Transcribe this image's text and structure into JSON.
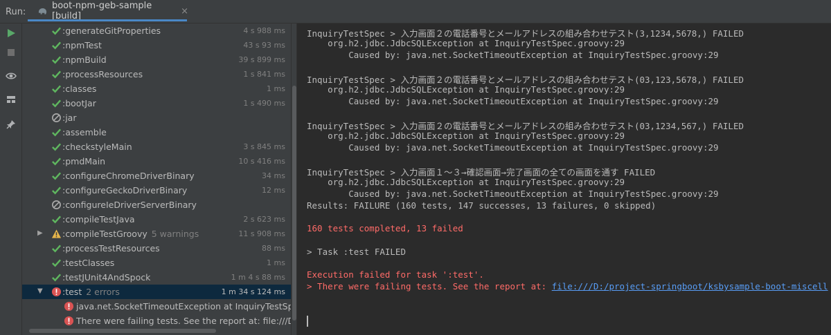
{
  "header": {
    "run_label": "Run:",
    "tab_title": "boot-npm-geb-sample [build]",
    "tab_close": "×"
  },
  "colors": {
    "success": "#5fb65f",
    "error": "#d95353",
    "warning": "#e6b54a",
    "accent": "#4a88c7",
    "link": "#589df6"
  },
  "tree": {
    "items": [
      {
        "name": ":generateGitProperties",
        "time": "4 s 988 ms",
        "status": "ok"
      },
      {
        "name": ":npmTest",
        "time": "43 s 93 ms",
        "status": "ok"
      },
      {
        "name": ":npmBuild",
        "time": "39 s 899 ms",
        "status": "ok"
      },
      {
        "name": ":processResources",
        "time": "1 s 841 ms",
        "status": "ok"
      },
      {
        "name": ":classes",
        "time": "1 ms",
        "status": "ok"
      },
      {
        "name": ":bootJar",
        "time": "1 s 490 ms",
        "status": "ok"
      },
      {
        "name": ":jar",
        "time": "",
        "status": "skipped"
      },
      {
        "name": ":assemble",
        "time": "",
        "status": "ok"
      },
      {
        "name": ":checkstyleMain",
        "time": "3 s 845 ms",
        "status": "ok"
      },
      {
        "name": ":pmdMain",
        "time": "10 s 416 ms",
        "status": "ok"
      },
      {
        "name": ":configureChromeDriverBinary",
        "time": "34 ms",
        "status": "ok"
      },
      {
        "name": ":configureGeckoDriverBinary",
        "time": "12 ms",
        "status": "ok"
      },
      {
        "name": ":configureIeDriverServerBinary",
        "time": "",
        "status": "skipped"
      },
      {
        "name": ":compileTestJava",
        "time": "2 s 623 ms",
        "status": "ok"
      },
      {
        "name": ":compileTestGroovy",
        "extra": "5 warnings",
        "time": "11 s 908 ms",
        "status": "warning"
      },
      {
        "name": ":processTestResources",
        "time": "88 ms",
        "status": "ok"
      },
      {
        "name": ":testClasses",
        "time": "1 ms",
        "status": "ok"
      },
      {
        "name": ":testJUnit4AndSpock",
        "time": "1 m 4 s 88 ms",
        "status": "ok"
      },
      {
        "name": ":test",
        "extra": "2 errors",
        "time": "1 m 34 s 124 ms",
        "status": "error"
      },
      {
        "name": "java.net.SocketTimeoutException at InquiryTestSpec.gro",
        "time": "",
        "status": "error"
      },
      {
        "name": "There were failing tests. See the report at: file:///D:/pro",
        "time": "",
        "status": "error"
      }
    ]
  },
  "console": {
    "lines": [
      "InquiryTestSpec > 入力画面２の電話番号とメールアドレスの組み合わせテスト(3,1234,5678,) FAILED",
      "    org.h2.jdbc.JdbcSQLException at InquiryTestSpec.groovy:29",
      "        Caused by: java.net.SocketTimeoutException at InquiryTestSpec.groovy:29",
      "InquiryTestSpec > 入力画面２の電話番号とメールアドレスの組み合わせテスト(03,123,5678,) FAILED",
      "    org.h2.jdbc.JdbcSQLException at InquiryTestSpec.groovy:29",
      "        Caused by: java.net.SocketTimeoutException at InquiryTestSpec.groovy:29",
      "InquiryTestSpec > 入力画面２の電話番号とメールアドレスの組み合わせテスト(03,1234,567,) FAILED",
      "    org.h2.jdbc.JdbcSQLException at InquiryTestSpec.groovy:29",
      "        Caused by: java.net.SocketTimeoutException at InquiryTestSpec.groovy:29",
      "InquiryTestSpec > 入力画面１～３→確認画面→完了画面の全ての画面を通す FAILED",
      "    org.h2.jdbc.JdbcSQLException at InquiryTestSpec.groovy:29",
      "        Caused by: java.net.SocketTimeoutException at InquiryTestSpec.groovy:29",
      "Results: FAILURE (160 tests, 147 successes, 13 failures, 0 skipped)",
      "160 tests completed, 13 failed",
      "> Task :test FAILED",
      "Execution failed for task ':test'.",
      "> There were failing tests. See the report at: "
    ],
    "report_link": "file:///D:/project-springboot/ksbysample-boot-miscell"
  }
}
